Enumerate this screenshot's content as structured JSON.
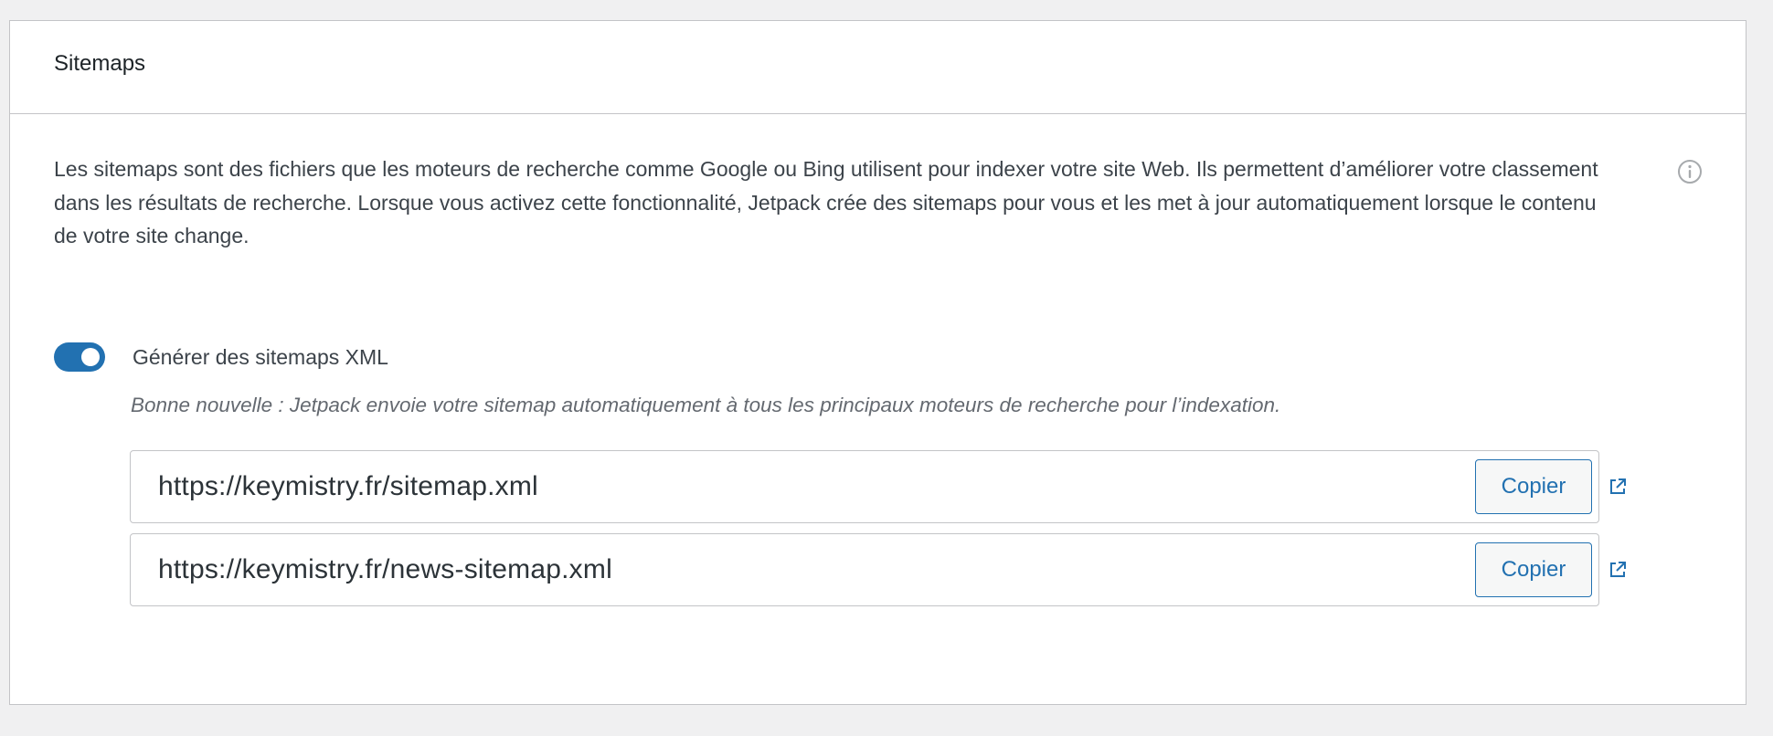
{
  "card": {
    "title": "Sitemaps",
    "description": "Les sitemaps sont des fichiers que les moteurs de recherche comme Google ou Bing utilisent pour indexer votre site Web. Ils permettent d’améliorer votre classement dans les résultats de recherche. Lorsque vous activez cette fonctionnalité, Jetpack crée des sitemaps pour vous et les met à jour automatiquement lorsque le contenu de votre site change.",
    "info_icon": "info-icon"
  },
  "toggle": {
    "label": "Générer des sitemaps XML",
    "checked": true
  },
  "note": "Bonne nouvelle : Jetpack envoie votre sitemap automatiquement à tous les principaux moteurs de recherche pour l’indexation.",
  "sitemaps": [
    {
      "url": "https://keymistry.fr/sitemap.xml",
      "copy_label": "Copier",
      "icon": "external-link-icon"
    },
    {
      "url": "https://keymistry.fr/news-sitemap.xml",
      "copy_label": "Copier",
      "icon": "external-link-icon"
    }
  ],
  "colors": {
    "accent": "#2271b1",
    "border": "#c3c4c7",
    "background": "#f0f0f1"
  }
}
